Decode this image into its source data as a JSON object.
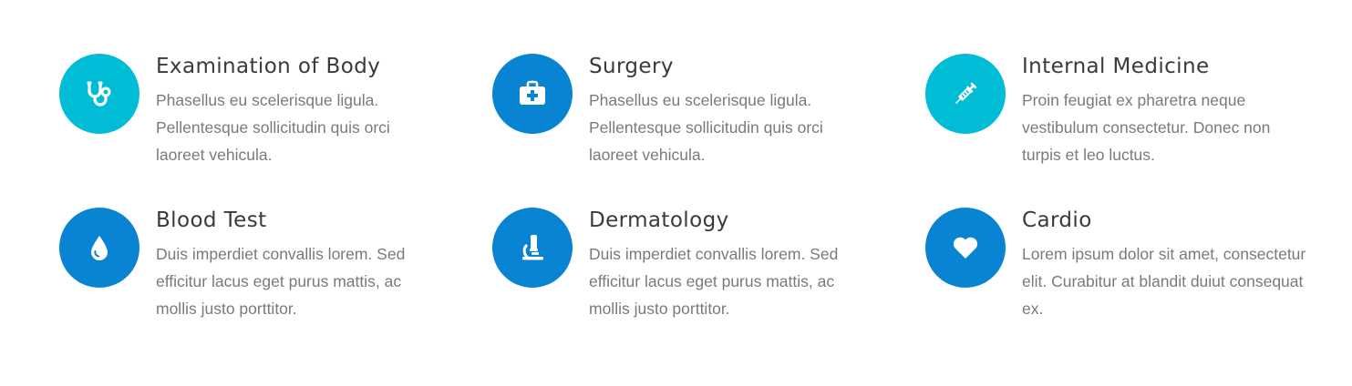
{
  "colors": {
    "cyan": "#00bcd4",
    "blue": "#0984d2",
    "title": "#3a3a3a",
    "text": "#7a7a7a"
  },
  "services": [
    {
      "title": "Examination of Body",
      "description": "Phasellus eu scelerisque ligula. Pellentesque sollicitudin quis orci laoreet vehicula.",
      "icon": "stethoscope-icon",
      "color": "#00bcd4"
    },
    {
      "title": "Surgery",
      "description": "Phasellus eu scelerisque ligula. Pellentesque sollicitudin quis orci laoreet vehicula.",
      "icon": "medkit-icon",
      "color": "#0984d2"
    },
    {
      "title": "Internal Medicine",
      "description": "Proin feugiat ex pharetra neque vestibulum consectetur. Donec non turpis et leo luctus.",
      "icon": "syringe-icon",
      "color": "#00bcd4"
    },
    {
      "title": "Blood Test",
      "description": "Duis imperdiet convallis lorem. Sed efficitur lacus eget purus mattis, ac mollis justo porttitor.",
      "icon": "blood-drop-icon",
      "color": "#0984d2"
    },
    {
      "title": "Dermatology",
      "description": "Duis imperdiet convallis lorem. Sed efficitur lacus eget purus mattis, ac mollis justo porttitor.",
      "icon": "microscope-icon",
      "color": "#0984d2"
    },
    {
      "title": "Cardio",
      "description": "Lorem ipsum dolor sit amet, consectetur elit. Curabitur at blandit duiut consequat ex.",
      "icon": "heart-icon",
      "color": "#0984d2"
    }
  ]
}
